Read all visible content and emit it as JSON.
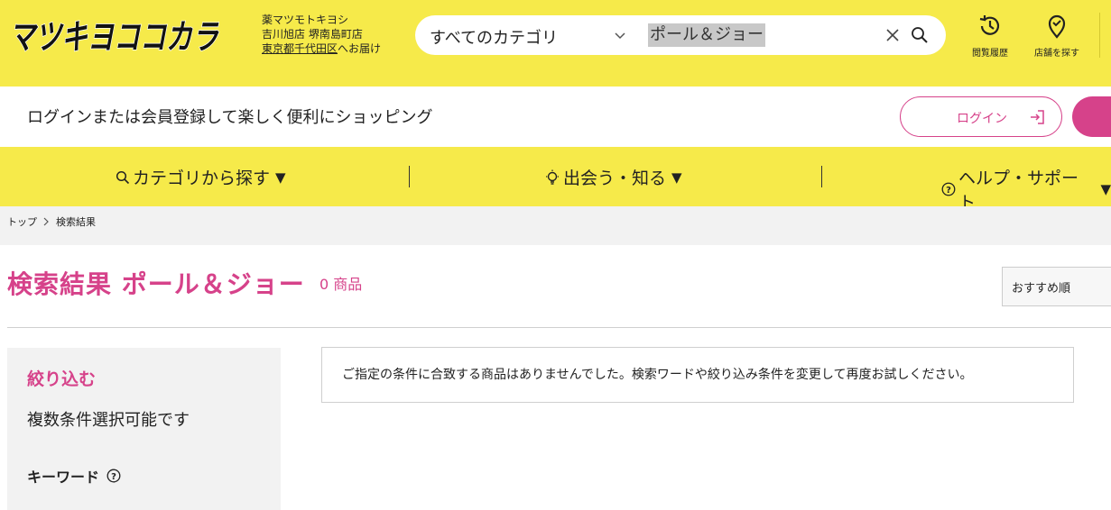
{
  "header": {
    "logo_text": "マツキヨココカラ",
    "store_line1": "薬マツモトキヨシ",
    "store_line2": "吉川旭店 堺南島町店",
    "store_address": "東京都千代田区",
    "store_delivery": "へお届け",
    "search": {
      "category": "すべてのカテゴリ",
      "keyword": "ポール＆ジョー"
    },
    "history_label": "閲覧履歴",
    "store_finder_label": "店舗を探す"
  },
  "loginbar": {
    "message": "ログインまたは会員登録して楽しく便利にショッピング",
    "login_label": "ログイン"
  },
  "nav": {
    "items": [
      {
        "label": "カテゴリから探す",
        "arrow": "▼"
      },
      {
        "label": "出会う・知る",
        "arrow": "▼"
      },
      {
        "label": "ヘルプ・サポート",
        "arrow": "▼"
      }
    ]
  },
  "breadcrumb": {
    "items": [
      "トップ",
      "検索結果"
    ]
  },
  "results": {
    "title": "検索結果 ポール＆ジョー",
    "count": "0 商品",
    "sort": "おすすめ順",
    "empty_message": "ご指定の条件に合致する商品はありませんでした。検索ワードや絞り込み条件を変更して再度お試しください。"
  },
  "sidebar": {
    "heading": "絞り込む",
    "subtitle": "複数条件選択可能です",
    "keyword_label": "キーワード"
  },
  "colors": {
    "brand_yellow": "#f6ea4a",
    "accent_pink": "#d6428a"
  }
}
